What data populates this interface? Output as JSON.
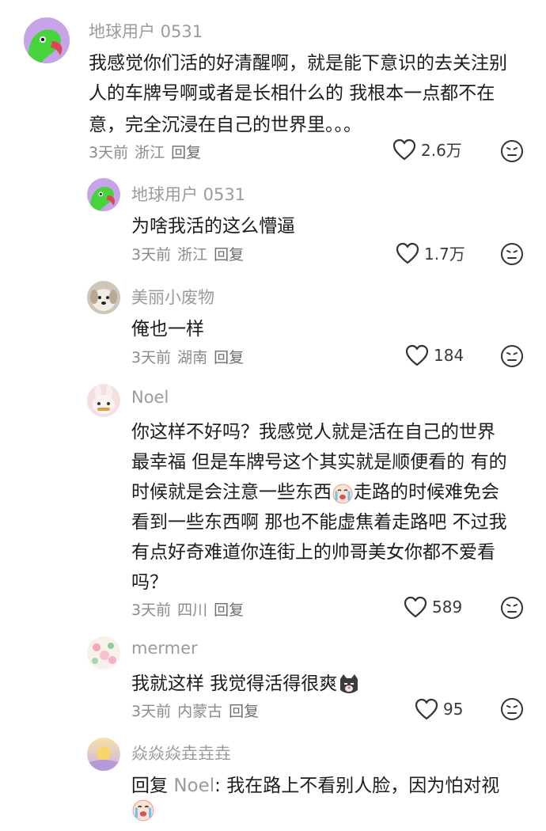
{
  "comments": [
    {
      "user": "地球用户 0531",
      "lines": [
        "我感觉你们活的好清醒啊，就是能下意识的去关注别",
        "人的车牌号啊或者是长相什么的 我根本一点都不在",
        "意，完全沉浸在自己的世界里。。。"
      ],
      "time": "3天前",
      "location": "浙江",
      "reply": "回复",
      "likes": "2.6万"
    },
    {
      "user": "地球用户 0531",
      "lines": [
        "为啥我活的这么懵逼"
      ],
      "time": "3天前",
      "location": "浙江",
      "reply": "回复",
      "likes": "1.7万"
    },
    {
      "user": "美丽小废物",
      "lines": [
        "俺也一样"
      ],
      "time": "3天前",
      "location": "湖南",
      "reply": "回复",
      "likes": "184"
    },
    {
      "user": "Noel",
      "lines": [
        "你这样不好吗？我感觉人就是活在自己的世界",
        "最幸福 但是车牌号这个其实就是顺便看的 有的",
        "时候就是会注意一些东西",
        "走路的时候难免会",
        "看到一些东西啊 那也不能虚焦着走路吧 不过我",
        "有点好奇难道你连街上的帅哥美女你都不爱看",
        "吗？"
      ],
      "time": "3天前",
      "location": "四川",
      "reply": "回复",
      "likes": "589"
    },
    {
      "user": "mermer",
      "lines": [
        "我就这样 我觉得活得很爽"
      ],
      "time": "3天前",
      "location": "内蒙古",
      "reply": "回复",
      "likes": "95"
    },
    {
      "user": "焱焱焱垚垚垚",
      "lines": [
        "回复 ",
        "Noel",
        ": 我在路上不看别人脸，因为怕对视"
      ]
    }
  ],
  "icons": {
    "like": "heart-outline-icon",
    "dislike": "neutral-face-icon"
  },
  "colors": {
    "username": "#9b9b9b",
    "text": "#1c1c1c",
    "meta": "#8a8a8a"
  }
}
